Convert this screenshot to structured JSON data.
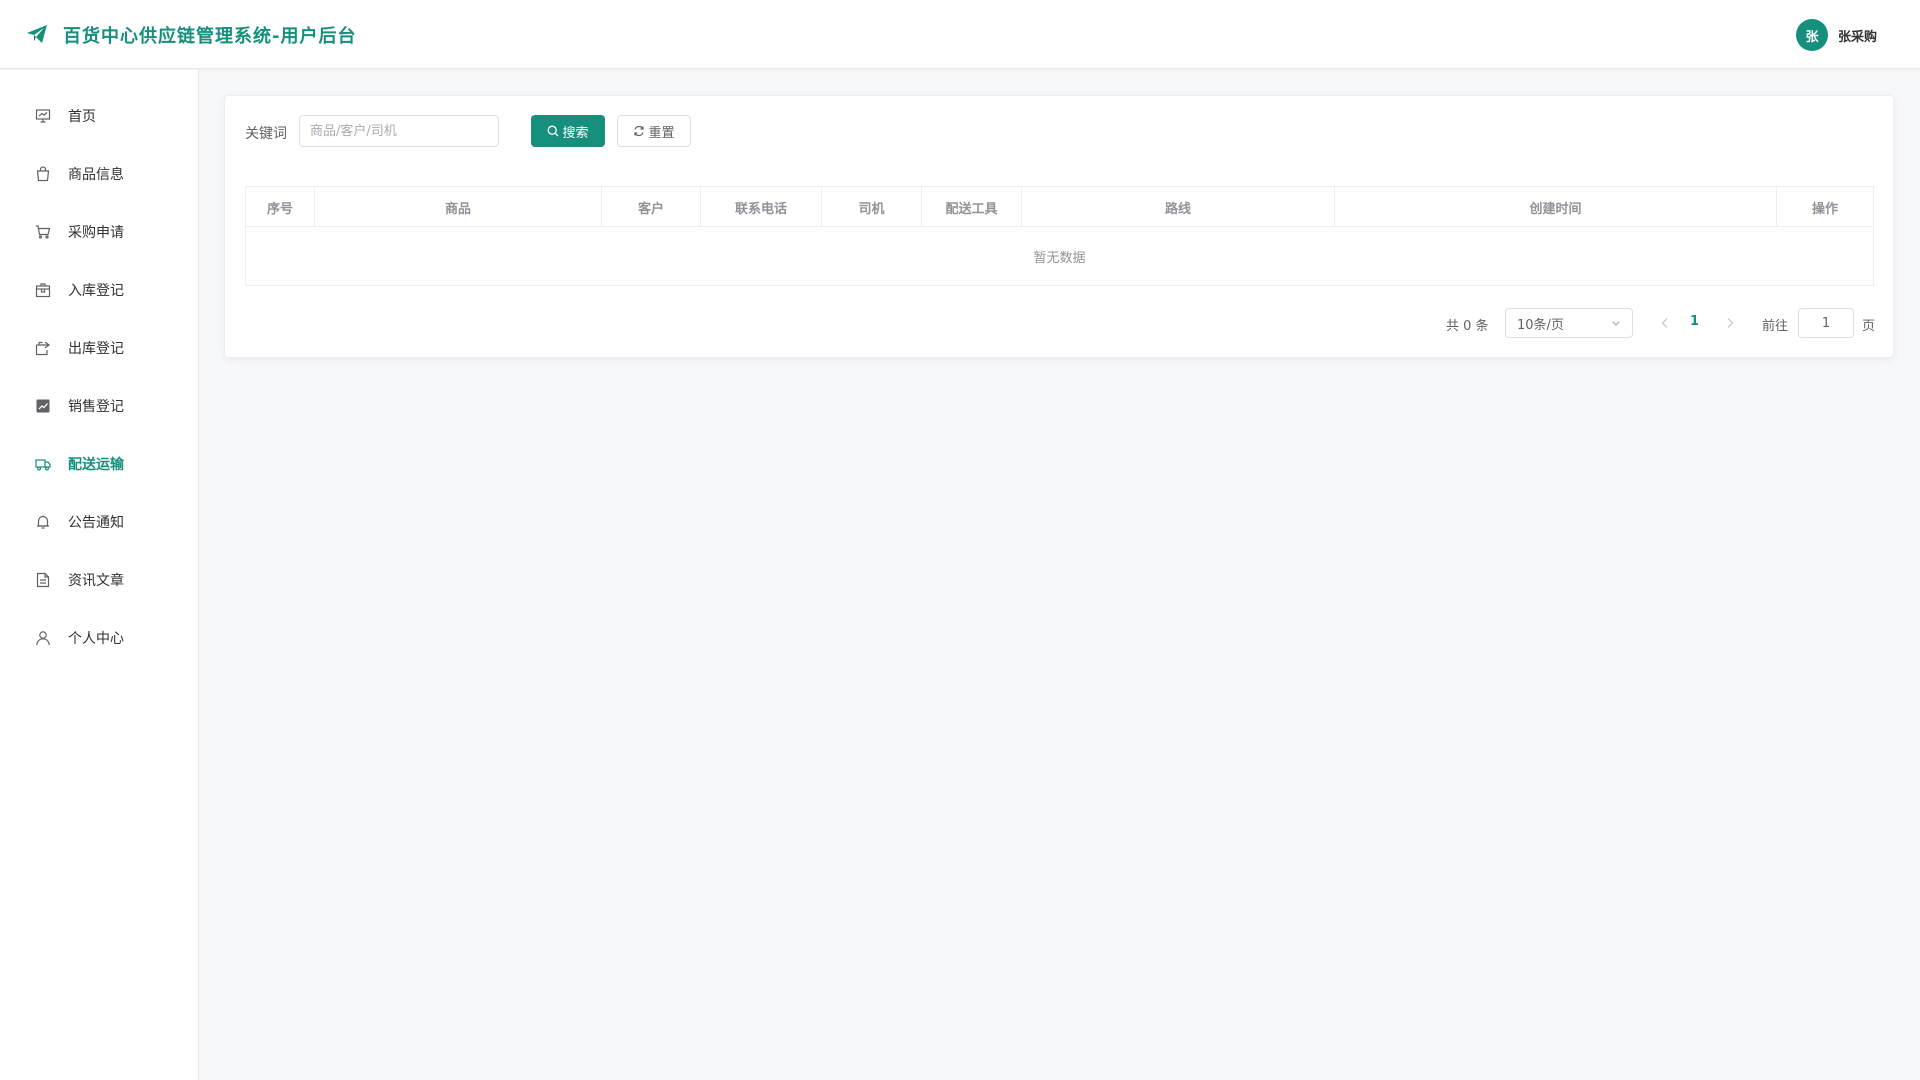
{
  "app": {
    "title": "百货中心供应链管理系统-用户后台",
    "brand_color": "#168f7d"
  },
  "user": {
    "avatar_text": "张",
    "name": "张采购"
  },
  "sidebar": {
    "items": [
      {
        "label": "首页",
        "icon": "presentation-icon"
      },
      {
        "label": "商品信息",
        "icon": "shopping-bag-icon"
      },
      {
        "label": "采购申请",
        "icon": "shopping-cart-icon"
      },
      {
        "label": "入库登记",
        "icon": "inbox-box-icon"
      },
      {
        "label": "出库登记",
        "icon": "outbox-box-icon"
      },
      {
        "label": "销售登记",
        "icon": "chart-line-icon"
      },
      {
        "label": "配送运输",
        "icon": "truck-icon",
        "active": true
      },
      {
        "label": "公告通知",
        "icon": "bell-icon"
      },
      {
        "label": "资讯文章",
        "icon": "document-icon"
      },
      {
        "label": "个人中心",
        "icon": "user-icon"
      }
    ]
  },
  "search": {
    "label": "关键词",
    "placeholder": "商品/客户/司机",
    "value": "",
    "search_label": "搜索",
    "reset_label": "重置"
  },
  "table": {
    "columns": [
      "序号",
      "商品",
      "客户",
      "联系电话",
      "司机",
      "配送工具",
      "路线",
      "创建时间",
      "操作"
    ],
    "rows": [],
    "empty_text": "暂无数据"
  },
  "pagination": {
    "total_text": "共 0 条",
    "page_size": "10条/页",
    "current_page": "1",
    "goto_label": "前往",
    "goto_value": "1",
    "page_suffix": "页"
  }
}
